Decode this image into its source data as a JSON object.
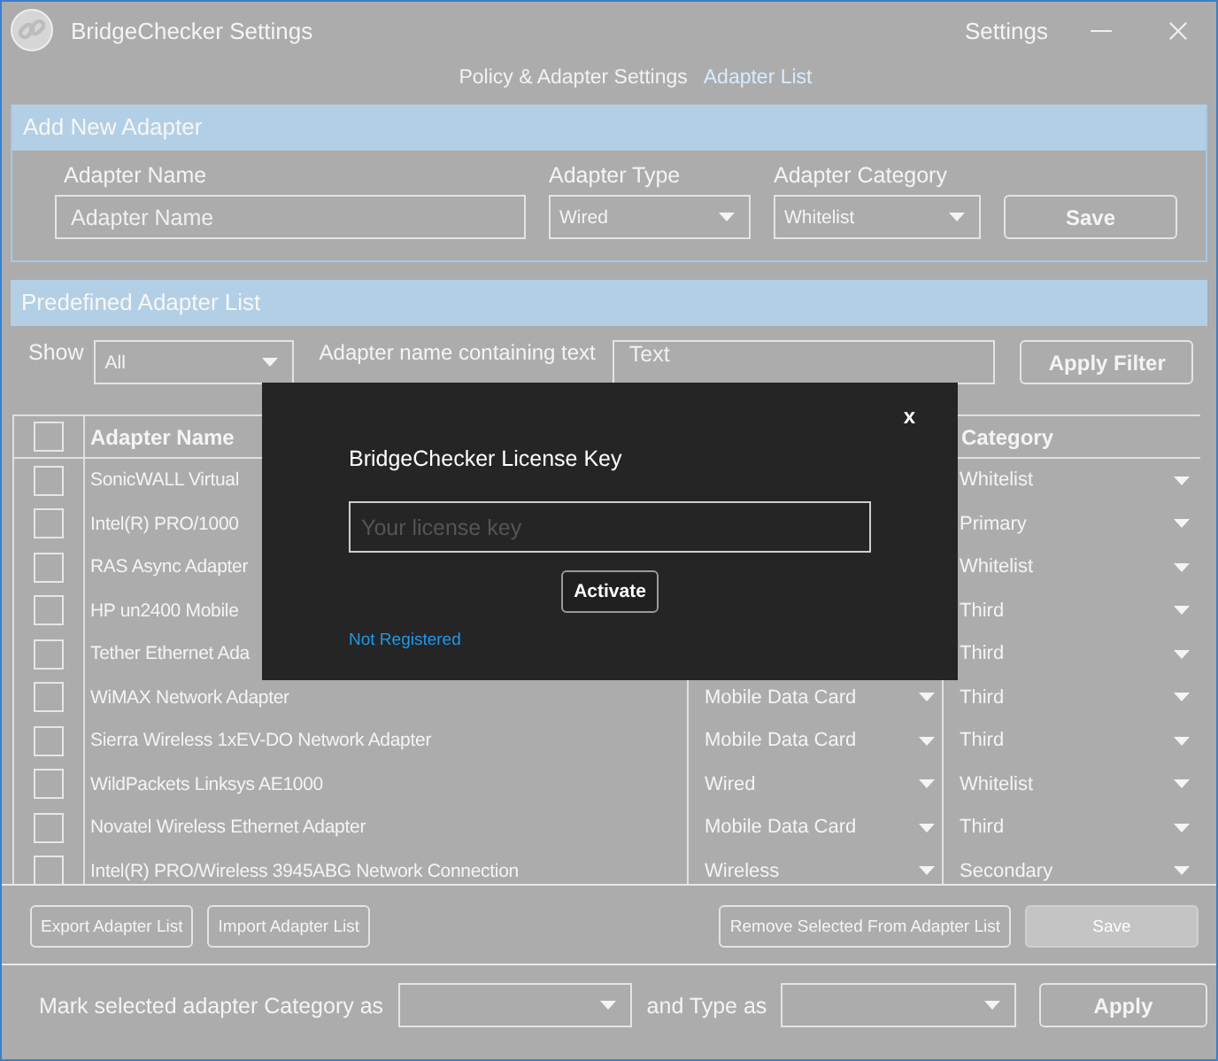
{
  "window": {
    "title": "BridgeChecker Settings",
    "menu": "Settings"
  },
  "tabs": [
    {
      "label": "Policy & Adapter Settings",
      "selected": false
    },
    {
      "label": "Adapter List",
      "selected": true
    }
  ],
  "add_section": {
    "title": "Add New Adapter",
    "name_label": "Adapter Name",
    "name_placeholder": "Adapter Name",
    "type_label": "Adapter Type",
    "type_value": "Wired",
    "category_label": "Adapter Category",
    "category_value": "Whitelist",
    "save": "Save"
  },
  "list_section": {
    "title": "Predefined Adapter List",
    "show_label": "Show",
    "show_value": "All",
    "filter_label": "Adapter name containing text",
    "filter_placeholder": "Text",
    "apply_filter": "Apply Filter"
  },
  "table": {
    "select_all_checked": false,
    "columns": [
      {
        "label": "Adapter Name"
      },
      {
        "label": "Category"
      }
    ],
    "rows": [
      {
        "name": "SonicWALL Virtual",
        "category": "Whitelist",
        "checked": false
      },
      {
        "name": "Intel(R) PRO/1000",
        "category": "Primary",
        "checked": false
      },
      {
        "name": "RAS Async Adapter",
        "category": "Whitelist",
        "checked": false
      },
      {
        "name": "HP un2400 Mobile",
        "category": "Third",
        "checked": false
      },
      {
        "name": "Tether Ethernet Ada",
        "category": "Third",
        "checked": false
      },
      {
        "name": "WiMAX Network Adapter",
        "type": "Mobile Data Card",
        "category": "Third",
        "checked": false
      },
      {
        "name": "Sierra Wireless 1xEV-DO Network Adapter",
        "type": "Mobile Data Card",
        "category": "Third",
        "checked": false
      },
      {
        "name": "WildPackets Linksys AE1000",
        "type": "Wired",
        "category": "Whitelist",
        "checked": false
      },
      {
        "name": "Novatel Wireless Ethernet Adapter",
        "type": "Mobile Data Card",
        "category": "Third",
        "checked": false
      },
      {
        "name": "Intel(R) PRO/Wireless 3945ABG Network Connection",
        "type": "Wireless",
        "category": "Secondary",
        "checked": false
      }
    ]
  },
  "actions": [
    {
      "label": "Export Adapter List",
      "disabled": false
    },
    {
      "label": "Import Adapter List",
      "disabled": false
    },
    {
      "label": "Remove Selected From Adapter List",
      "disabled": false
    },
    {
      "label": "Save",
      "disabled": true
    }
  ],
  "mark": {
    "category_label": "Mark selected adapter Category as",
    "type_label": "and Type as",
    "apply": "Apply"
  },
  "dialog": {
    "close": "x",
    "title": "BridgeChecker License Key",
    "placeholder": "Your license key",
    "activate": "Activate",
    "status": "Not Registered"
  }
}
